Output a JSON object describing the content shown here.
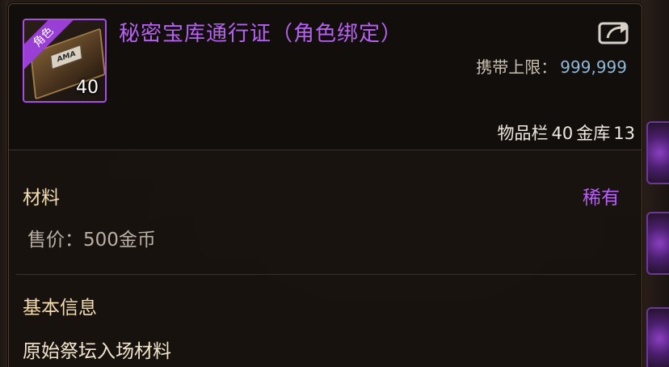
{
  "item": {
    "name": "秘密宝库通行证（角色绑定）",
    "bind_tag": "角色",
    "icon_count": "40",
    "icon_plate_text": "AMA",
    "carry_limit_label": "携带上限：",
    "carry_limit_value": "999,999",
    "inventory_label": "物品栏",
    "inventory_count": "40",
    "storage_label": "金库",
    "storage_count": "13"
  },
  "details": {
    "category": "材料",
    "rarity": "稀有",
    "price": "售价：500金币",
    "basic_info_title": "基本信息",
    "description": "原始祭坛入场材料"
  },
  "colors": {
    "rarity_purple": "#b661f2",
    "section_gold": "#f2dcb0",
    "carry_value_blue": "#8fb8d8"
  },
  "icons": {
    "share": "share-export-icon",
    "item": "secret-vault-pass-book-icon"
  }
}
